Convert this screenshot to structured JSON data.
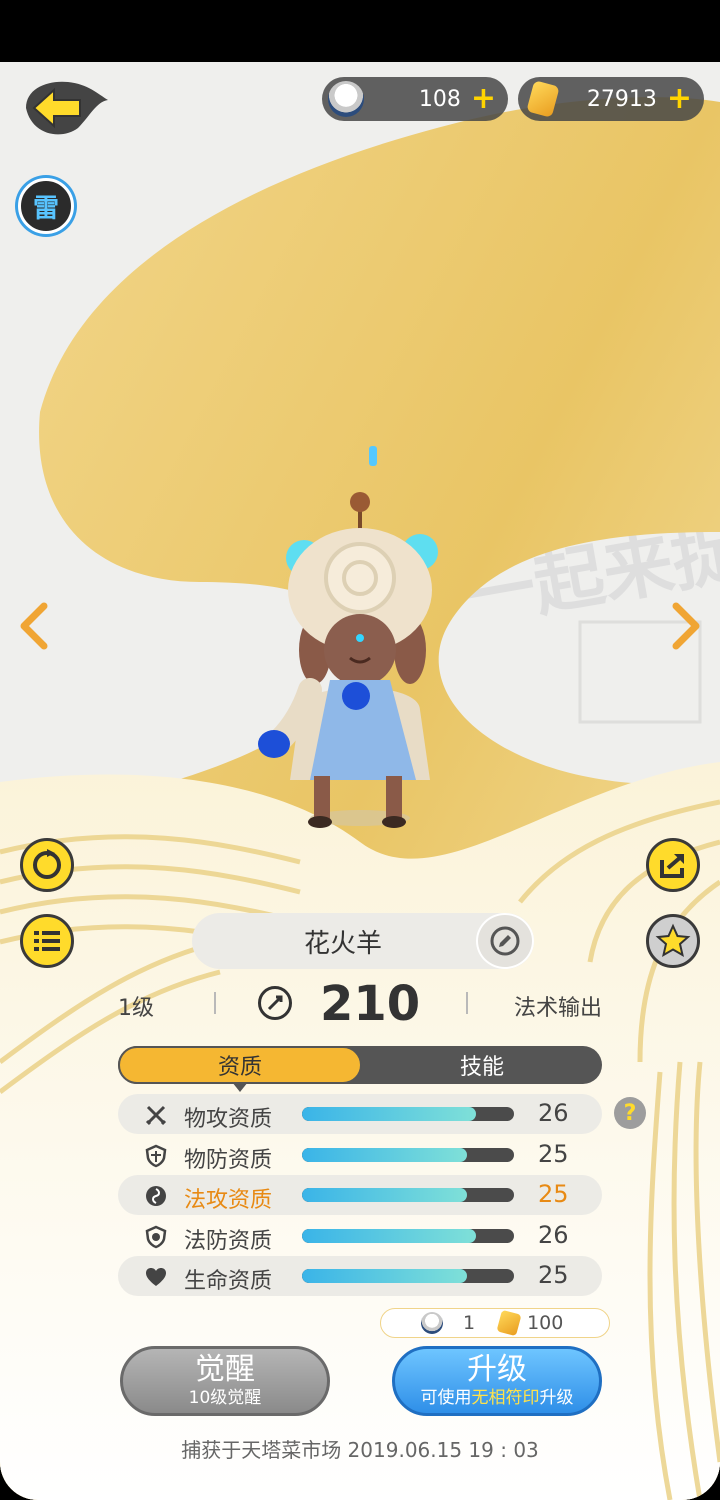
{
  "currency": {
    "soul_count": "108",
    "crystal_count": "27913",
    "plus": "+"
  },
  "element_badge": "雷",
  "pet": {
    "name": "花火羊",
    "level": "1级",
    "power": "210",
    "role": "法术输出"
  },
  "tabs": [
    {
      "label": "资质",
      "active": true
    },
    {
      "label": "技能",
      "active": false
    }
  ],
  "attributes": [
    {
      "label": "物攻资质",
      "value": "26",
      "fill": 0.82,
      "icon": "swords-icon",
      "highlight": false
    },
    {
      "label": "物防资质",
      "value": "25",
      "fill": 0.78,
      "icon": "shield-icon",
      "highlight": false
    },
    {
      "label": "法攻资质",
      "value": "25",
      "fill": 0.78,
      "icon": "magic-orb-icon",
      "highlight": true
    },
    {
      "label": "法防资质",
      "value": "26",
      "fill": 0.82,
      "icon": "magic-shield-icon",
      "highlight": false
    },
    {
      "label": "生命资质",
      "value": "25",
      "fill": 0.78,
      "icon": "heart-icon",
      "highlight": false
    }
  ],
  "help": "?",
  "cost": {
    "soul": "1",
    "crystal": "100"
  },
  "awaken": {
    "title": "觉醒",
    "subtitle": "10级觉醒"
  },
  "upgrade": {
    "title": "升级",
    "subtitle_prefix": "可使用",
    "subtitle_highlight": "无相符印",
    "subtitle_suffix": "升级"
  },
  "capture_info": "捕获于天塔菜市场  2019.06.15   19 : 03",
  "colors": {
    "accent_yellow": "#ffdb2b",
    "tab_active": "#f5b732",
    "bar_fill": "#3ab4e8",
    "highlight_text": "#e88a14",
    "upgrade_blue": "#2f8fe8"
  }
}
